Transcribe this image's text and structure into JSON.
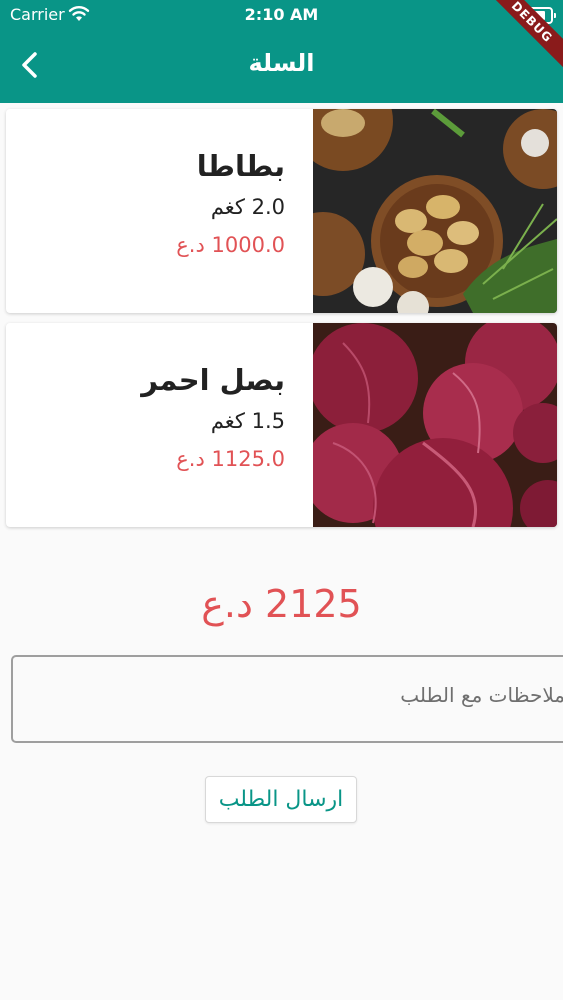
{
  "status_bar": {
    "carrier": "Carrier",
    "time": "2:10 AM"
  },
  "app_bar": {
    "title": "السلة",
    "back_icon": "chevron-left-icon",
    "debug_banner": "DEBUG",
    "color": "#099587"
  },
  "cart_items": [
    {
      "name": "بطاطا",
      "quantity": "2.0 كغم",
      "price": "1000.0 د.ع",
      "image": "potatoes"
    },
    {
      "name": "بصل احمر",
      "quantity": "1.5 كغم",
      "price": "1125.0 د.ع",
      "image": "red-onions"
    }
  ],
  "total": "2125 د.ع",
  "notes": {
    "placeholder": "ملاحظات مع الطلب",
    "value": ""
  },
  "submit_label": "ارسال الطلب",
  "colors": {
    "accent": "#099587",
    "price": "#e15255"
  }
}
